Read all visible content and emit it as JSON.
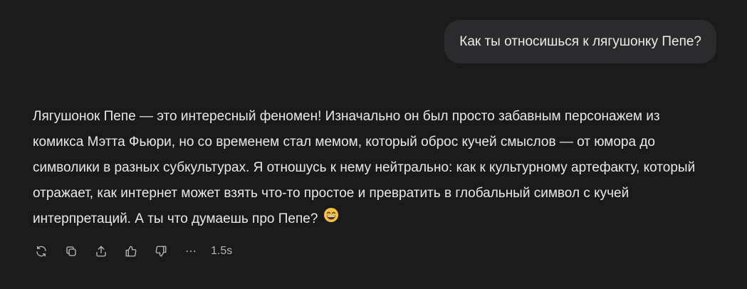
{
  "user_message": {
    "text": "Как ты относишься к лягушонку Пепе?"
  },
  "assistant_message": {
    "text": "Лягушонок Пепе — это интересный феномен! Изначально он был просто забавным персонажем из комикса Мэтта Фьюри, но со временем стал мемом, который оброс кучей смыслов — от юмора до символики в разных субкультурах. Я отношусь к нему нейтрально: как к культурному артефакту, который отражает, как интернет может взять что-то простое и превратить в глобальный символ с кучей интерпретаций. А ты что думаешь про Пепе?",
    "emoji": "grinning-face-with-smiling-eyes"
  },
  "toolbar": {
    "icons": [
      "regenerate-icon",
      "copy-icon",
      "share-icon",
      "thumbs-up-icon",
      "thumbs-down-icon",
      "more-icon"
    ],
    "response_time": "1.5s"
  },
  "colors": {
    "background": "#1a1a1b",
    "user_bubble": "#2b2b2d",
    "text": "#e8e8e8",
    "icon": "#b9b9b9"
  }
}
